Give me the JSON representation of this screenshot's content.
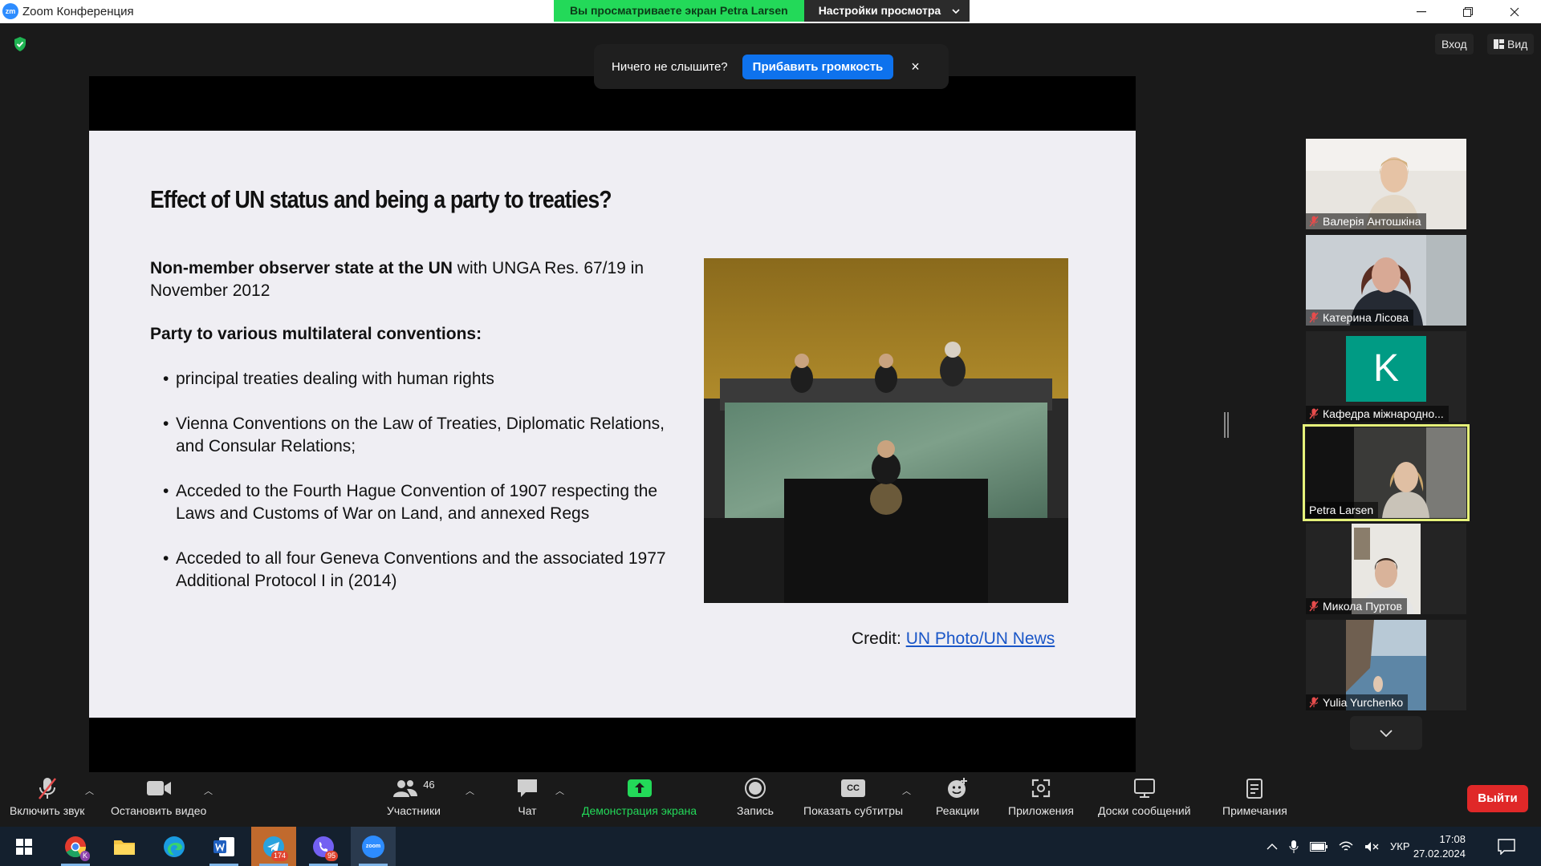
{
  "window": {
    "app_icon": "zm",
    "title": "Zoom Конференция",
    "banner_viewing": "Вы просматриваете экран Petra Larsen",
    "banner_options": "Настройки просмотра"
  },
  "top": {
    "login_label": "Вход",
    "view_label": "Вид"
  },
  "audio_popup": {
    "message": "Ничего не слышите?",
    "button": "Прибавить громкость",
    "close": "×"
  },
  "slide": {
    "title": "Effect of UN status and being a party to treaties?",
    "p1_bold": "Non-member observer state at the UN",
    "p1_rest": " with UNGA Res. 67/19 in November 2012",
    "p2_bold": "Party to various multilateral conventions:",
    "bullets": [
      "principal treaties dealing with human rights",
      "Vienna Conventions on the Law of Treaties, Diplomatic Relations, and Consular Relations;",
      "Acceded to the Fourth Hague Convention of 1907 respecting the Laws and Customs of War on Land, and annexed Regs",
      "Acceded to all four Geneva Conventions and the associated 1977 Additional Protocol I in (2014)"
    ],
    "credit_label": "Credit: ",
    "credit_link": "UN Photo/UN News"
  },
  "participants": [
    {
      "name": "Валерія Антошкіна",
      "muted": true
    },
    {
      "name": "Катерина Лісова",
      "muted": true
    },
    {
      "name": "Кафедра міжнародно...",
      "muted": true,
      "avatar_letter": "K"
    },
    {
      "name": "Petra Larsen",
      "muted": false,
      "active": true
    },
    {
      "name": "Микола Пуртов",
      "muted": true
    },
    {
      "name": "Yulia Yurchenko",
      "muted": true
    }
  ],
  "toolbar": {
    "unmute": "Включить звук",
    "stop_video": "Остановить видео",
    "participants": "Участники",
    "participants_count": "46",
    "chat": "Чат",
    "share": "Демонстрация экрана",
    "record": "Запись",
    "captions": "Показать субтитры",
    "captions_icon": "CC",
    "reactions": "Реакции",
    "apps": "Приложения",
    "whiteboards": "Доски сообщений",
    "notes": "Примечания",
    "leave": "Выйти"
  },
  "taskbar": {
    "telegram_badge": "174",
    "viber_badge": "95",
    "chrome_badge": "K",
    "zoom_label": "zoom",
    "language": "УКР",
    "time": "17:08",
    "date": "27.02.2024"
  },
  "colors": {
    "share_green": "#23d959",
    "primary_blue": "#0e72ed",
    "leave_red": "#e02828",
    "active_speaker": "#e6f27a",
    "taskbar": "#14202e"
  }
}
